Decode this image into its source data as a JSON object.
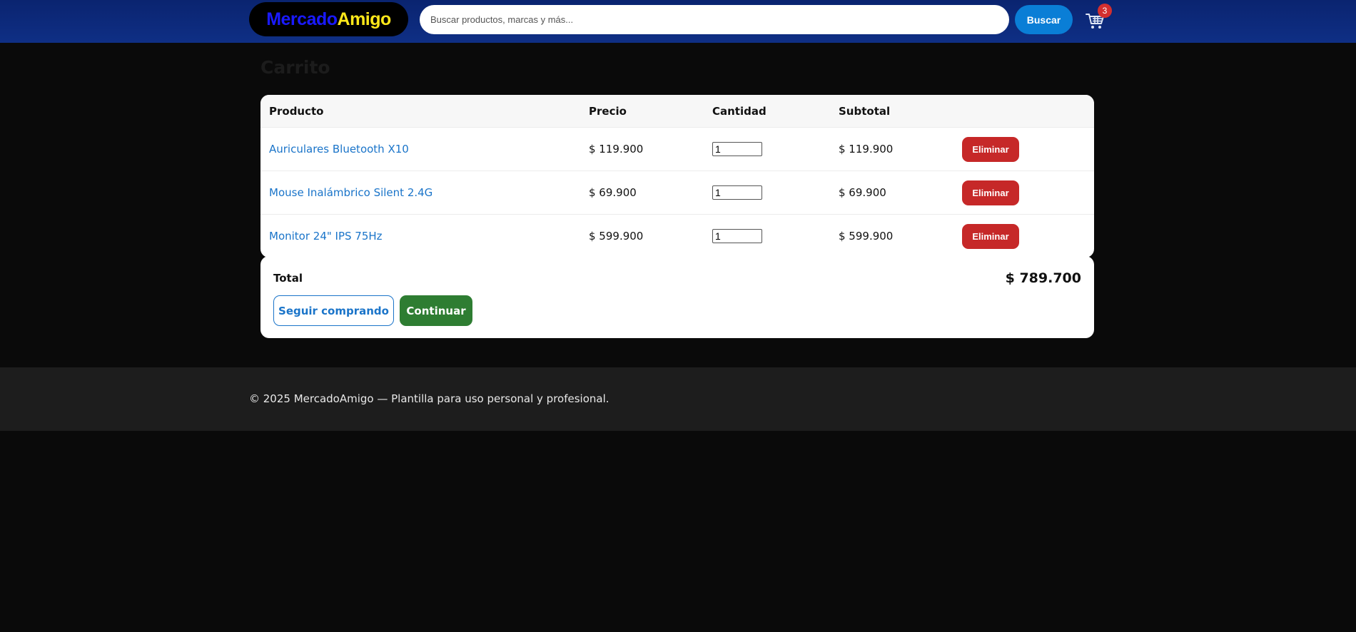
{
  "header": {
    "logo_part1": "Mercado",
    "logo_part2": "Amigo",
    "search_placeholder": "Buscar productos, marcas y más...",
    "search_button_label": "Buscar",
    "cart_icon": "cart-icon",
    "cart_count": "3"
  },
  "page": {
    "title": "Carrito"
  },
  "table": {
    "headers": [
      "Producto",
      "Precio",
      "Cantidad",
      "Subtotal",
      ""
    ],
    "rows": [
      {
        "product": "Auriculares Bluetooth X10",
        "price": "$ 119.900",
        "quantity": "1",
        "subtotal": "$ 119.900",
        "action": "Eliminar"
      },
      {
        "product": "Mouse Inalámbrico Silent 2.4G",
        "price": "$ 69.900",
        "quantity": "1",
        "subtotal": "$ 69.900",
        "action": "Eliminar"
      },
      {
        "product": "Monitor 24\" IPS 75Hz",
        "price": "$ 599.900",
        "quantity": "1",
        "subtotal": "$ 599.900",
        "action": "Eliminar"
      }
    ]
  },
  "totals": {
    "label": "Total",
    "value": "$ 789.700",
    "keep_shopping_label": "Seguir comprando",
    "continue_label": "Continuar"
  },
  "footer": {
    "text": "© 2025 MercadoAmigo — Plantilla para uso personal y profesional."
  },
  "colors": {
    "header_bg": "#0a2470",
    "accent": "#0a7ed6",
    "danger": "#c62828",
    "success": "#2e7d32",
    "link": "#1a74c9"
  }
}
